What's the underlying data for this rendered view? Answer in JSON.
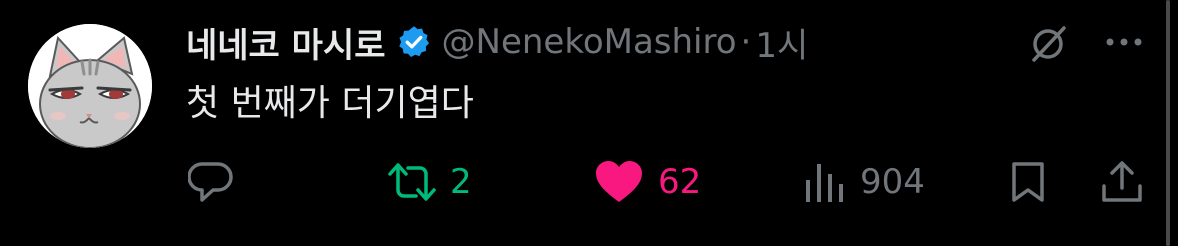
{
  "tweet": {
    "author": {
      "display_name": "네네코 마시로",
      "handle": "@NenekoMashiro",
      "verified": true
    },
    "separator": "·",
    "time": "1시",
    "text": "첫 번째가 더기엽다"
  },
  "actions": {
    "reply": {
      "icon": "reply-icon"
    },
    "retweet": {
      "icon": "retweet-icon",
      "count": "2",
      "color": "#00ba7c"
    },
    "like": {
      "icon": "heart-icon",
      "count": "62",
      "color": "#f91880"
    },
    "views": {
      "icon": "views-icon",
      "count": "904"
    },
    "bookmark": {
      "icon": "bookmark-icon"
    },
    "share": {
      "icon": "share-icon"
    }
  },
  "header_actions": {
    "grok": {
      "icon": "grok-icon"
    },
    "more": {
      "icon": "more-icon"
    }
  },
  "colors": {
    "background": "#000000",
    "primary_text": "#e7e9ea",
    "secondary_text": "#71767b",
    "verified_blue": "#1d9bf0"
  }
}
